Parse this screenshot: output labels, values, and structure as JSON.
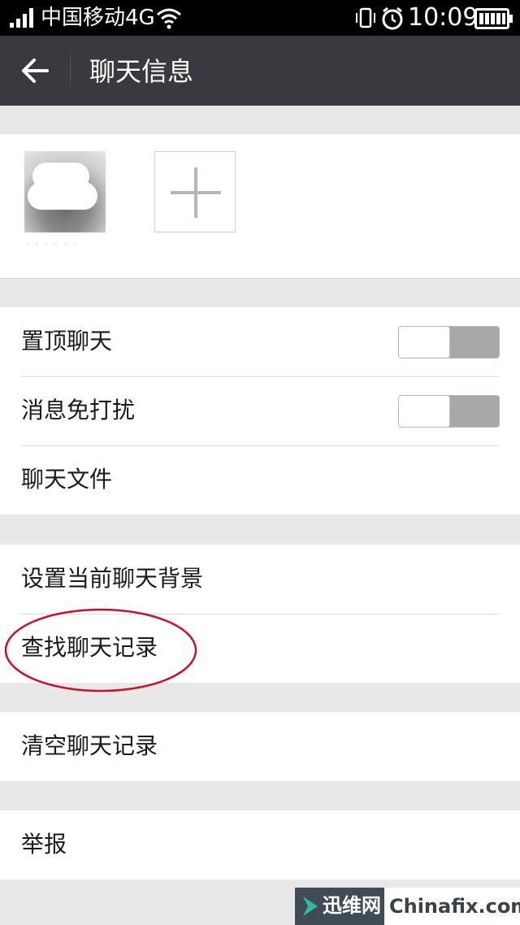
{
  "status_bar": {
    "carrier": "中国移动4G",
    "time": "10:09",
    "icons": [
      "signal-icon",
      "wifi-icon",
      "vibrate-icon",
      "alarm-icon",
      "battery-icon"
    ]
  },
  "header": {
    "title": "聊天信息",
    "back_icon": "back-arrow-icon",
    "background": "#393a3f"
  },
  "members": {
    "add_icon": "plus-icon"
  },
  "settings": {
    "pin_chat": {
      "label": "置顶聊天",
      "toggle_on": false
    },
    "do_not_disturb": {
      "label": "消息免打扰",
      "toggle_on": false
    },
    "chat_files": {
      "label": "聊天文件"
    },
    "set_background": {
      "label": "设置当前聊天背景"
    },
    "search_history": {
      "label": "查找聊天记录"
    },
    "clear_history": {
      "label": "清空聊天记录"
    },
    "report": {
      "label": "举报"
    }
  },
  "annotation": {
    "color": "#c8102e"
  },
  "watermark": {
    "cn": "迅维网",
    "en": "Chinafix.com"
  }
}
